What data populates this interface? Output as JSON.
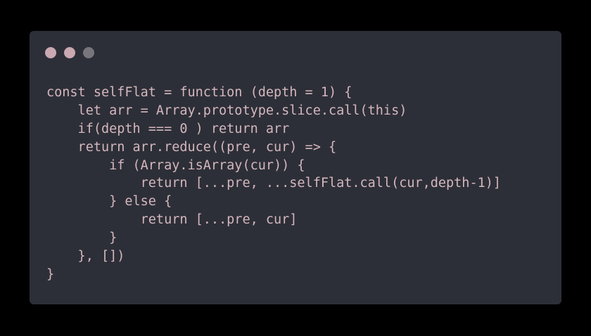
{
  "window": {
    "background": "#2d2f38",
    "dots": [
      {
        "name": "close-dot",
        "color": "#c9a8b2"
      },
      {
        "name": "minimize-dot",
        "color": "#c9a8b2"
      },
      {
        "name": "maximize-dot",
        "color": "#77767c"
      }
    ]
  },
  "code": {
    "language": "javascript",
    "text_color": "#d4b7bd",
    "lines": [
      "const selfFlat = function (depth = 1) {",
      "    let arr = Array.prototype.slice.call(this)",
      "    if(depth === 0 ) return arr",
      "    return arr.reduce((pre, cur) => {",
      "        if (Array.isArray(cur)) {",
      "            return [...pre, ...selfFlat.call(cur,depth-1)]",
      "        } else {",
      "            return [...pre, cur]",
      "        }",
      "    }, [])",
      "}"
    ]
  }
}
